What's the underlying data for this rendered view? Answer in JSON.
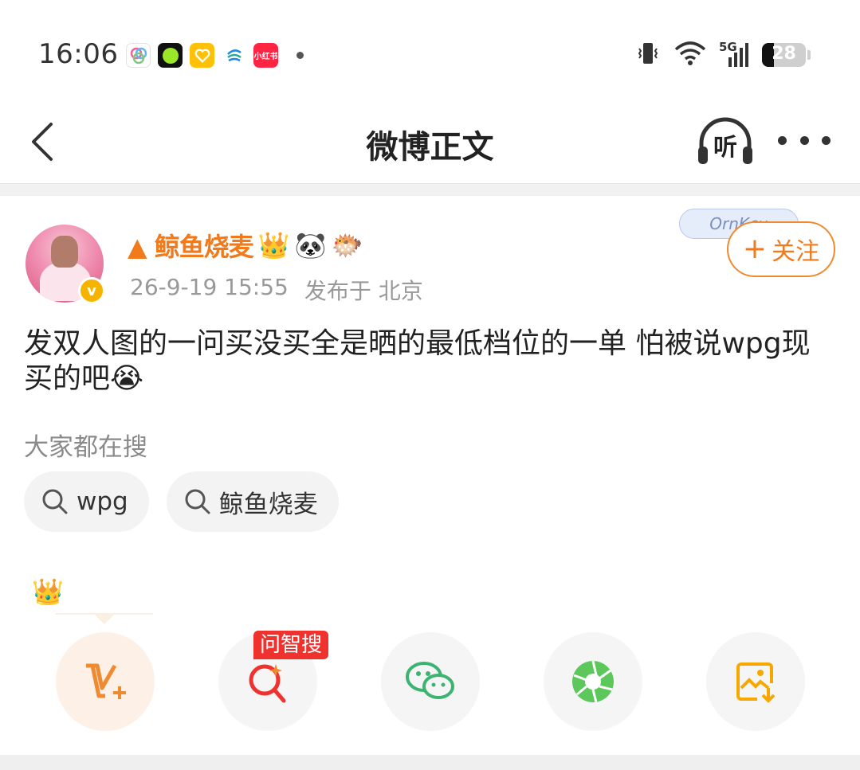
{
  "status_bar": {
    "time": "16:06",
    "network": "5G",
    "battery": "28",
    "battery_level": 0.28,
    "app_icons": [
      "photos-icon",
      "green-circle-app-icon",
      "yellow-heart-app-icon",
      "china-mobile-icon",
      "xiaohongshu-icon"
    ],
    "xiaohongshu_label": "小红书"
  },
  "nav": {
    "title": "微博正文",
    "listen_label": "听"
  },
  "post": {
    "username": "▲ 鲸鱼烧麦",
    "badges": [
      "👑",
      "🐼",
      "🐡"
    ],
    "verified_mark": "v",
    "date": "26-9-19 15:55",
    "location": "发布于 北京",
    "follow_label": "关注",
    "follow_plus": "+",
    "follow_decoration": "OrnKcu",
    "text": "发双人图的一问买没买全是晒的最低档位的一单 怕被说wpg现买的吧😭"
  },
  "search": {
    "label": "大家都在搜",
    "chips": [
      "wpg",
      "鲸鱼烧麦"
    ]
  },
  "crown": "👑",
  "share": {
    "ai_tag": "问智搜",
    "buttons": [
      "v-plus-icon",
      "ai-search-icon",
      "wechat-icon",
      "moments-icon",
      "save-image-icon"
    ]
  },
  "colors": {
    "accent_orange": "#f07a1c",
    "verified_gold": "#f6b400",
    "wechat_green": "#3cb371",
    "moments_green": "#5cc85c",
    "ai_red": "#f0322f"
  }
}
